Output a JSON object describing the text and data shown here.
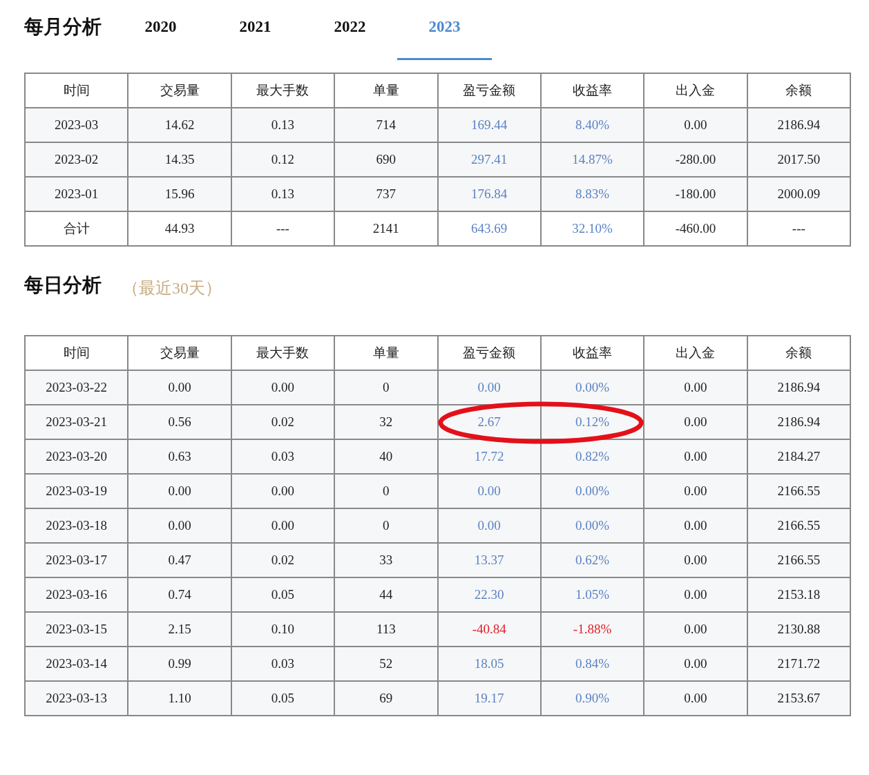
{
  "monthly": {
    "title": "每月分析",
    "tabs": [
      {
        "label": "2020",
        "selected": false
      },
      {
        "label": "2021",
        "selected": false
      },
      {
        "label": "2022",
        "selected": false
      },
      {
        "label": "2023",
        "selected": true
      }
    ],
    "table": {
      "columns": [
        "时间",
        "交易量",
        "最大手数",
        "单量",
        "盈亏金额",
        "收益率",
        "出入金",
        "余额"
      ],
      "rows": [
        {
          "kind": "data",
          "negative": false,
          "cells": [
            "2023-03",
            "14.62",
            "0.13",
            "714",
            "169.44",
            "8.40%",
            "0.00",
            "2186.94"
          ]
        },
        {
          "kind": "data",
          "negative": false,
          "cells": [
            "2023-02",
            "14.35",
            "0.12",
            "690",
            "297.41",
            "14.87%",
            "-280.00",
            "2017.50"
          ]
        },
        {
          "kind": "data",
          "negative": false,
          "cells": [
            "2023-01",
            "15.96",
            "0.13",
            "737",
            "176.84",
            "8.83%",
            "-180.00",
            "2000.09"
          ]
        },
        {
          "kind": "total",
          "negative": false,
          "cells": [
            "合计",
            "44.93",
            "---",
            "2141",
            "643.69",
            "32.10%",
            "-460.00",
            "---"
          ]
        }
      ]
    }
  },
  "daily": {
    "title": "每日分析",
    "subtitle": "（最近30天）",
    "table": {
      "columns": [
        "时间",
        "交易量",
        "最大手数",
        "单量",
        "盈亏金额",
        "收益率",
        "出入金",
        "余额"
      ],
      "rows": [
        {
          "negative": false,
          "circled": false,
          "cells": [
            "2023-03-22",
            "0.00",
            "0.00",
            "0",
            "0.00",
            "0.00%",
            "0.00",
            "2186.94"
          ]
        },
        {
          "negative": false,
          "circled": true,
          "cells": [
            "2023-03-21",
            "0.56",
            "0.02",
            "32",
            "2.67",
            "0.12%",
            "0.00",
            "2186.94"
          ]
        },
        {
          "negative": false,
          "circled": false,
          "cells": [
            "2023-03-20",
            "0.63",
            "0.03",
            "40",
            "17.72",
            "0.82%",
            "0.00",
            "2184.27"
          ]
        },
        {
          "negative": false,
          "circled": false,
          "cells": [
            "2023-03-19",
            "0.00",
            "0.00",
            "0",
            "0.00",
            "0.00%",
            "0.00",
            "2166.55"
          ]
        },
        {
          "negative": false,
          "circled": false,
          "cells": [
            "2023-03-18",
            "0.00",
            "0.00",
            "0",
            "0.00",
            "0.00%",
            "0.00",
            "2166.55"
          ]
        },
        {
          "negative": false,
          "circled": false,
          "cells": [
            "2023-03-17",
            "0.47",
            "0.02",
            "33",
            "13.37",
            "0.62%",
            "0.00",
            "2166.55"
          ]
        },
        {
          "negative": false,
          "circled": false,
          "cells": [
            "2023-03-16",
            "0.74",
            "0.05",
            "44",
            "22.30",
            "1.05%",
            "0.00",
            "2153.18"
          ]
        },
        {
          "negative": true,
          "circled": false,
          "cells": [
            "2023-03-15",
            "2.15",
            "0.10",
            "113",
            "-40.84",
            "-1.88%",
            "0.00",
            "2130.88"
          ]
        },
        {
          "negative": false,
          "circled": false,
          "cells": [
            "2023-03-14",
            "0.99",
            "0.03",
            "52",
            "18.05",
            "0.84%",
            "0.00",
            "2171.72"
          ]
        },
        {
          "negative": false,
          "circled": false,
          "cells": [
            "2023-03-13",
            "1.10",
            "0.05",
            "69",
            "19.17",
            "0.90%",
            "0.00",
            "2153.67"
          ]
        }
      ]
    }
  }
}
